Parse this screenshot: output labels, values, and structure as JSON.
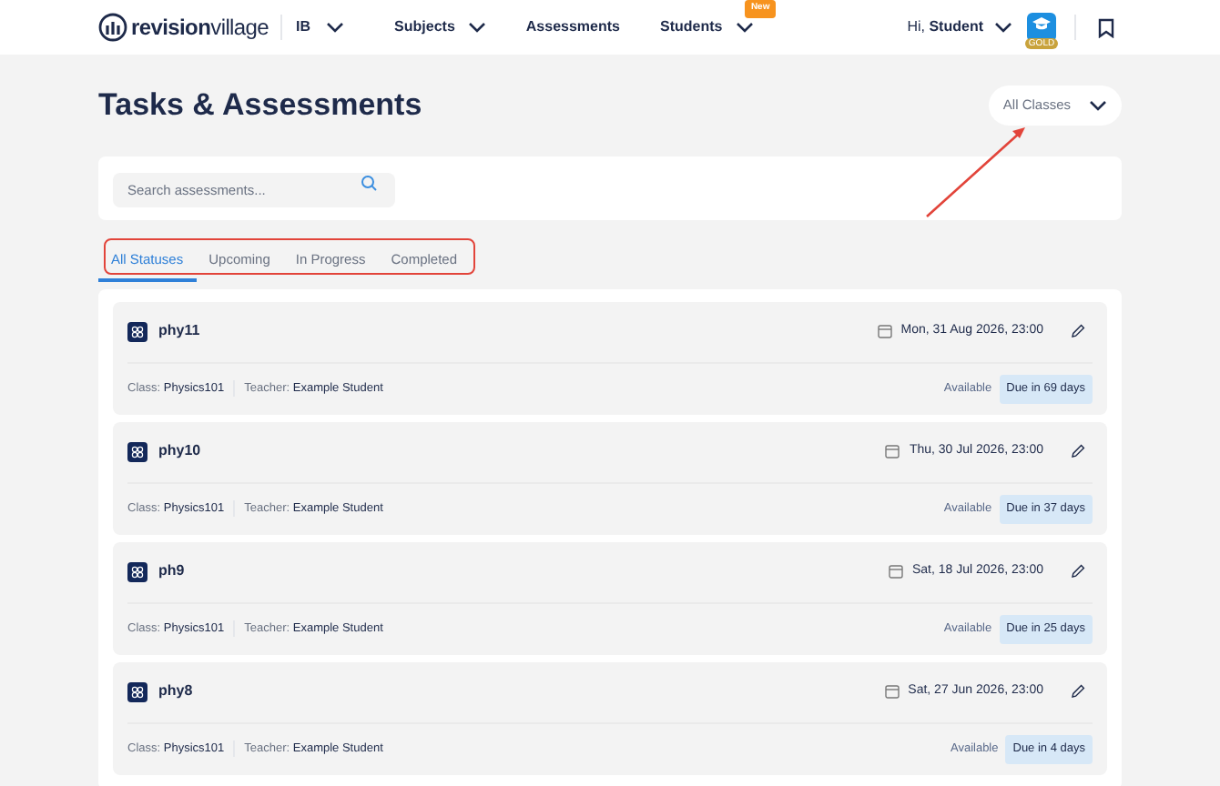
{
  "header": {
    "logo": {
      "bold": "revision",
      "light": "village"
    },
    "curriculum": "IB",
    "nav": [
      {
        "label": "Subjects",
        "dropdown": true
      },
      {
        "label": "Assessments",
        "dropdown": false
      },
      {
        "label": "Students",
        "dropdown": true,
        "badge": "New"
      }
    ],
    "greeting": "Hi,",
    "user": "Student",
    "membership": "GOLD"
  },
  "page": {
    "title": "Tasks & Assessments",
    "class_filter": "All Classes"
  },
  "search": {
    "placeholder": "Search assessments..."
  },
  "tabs": [
    {
      "label": "All Statuses",
      "selected": true
    },
    {
      "label": "Upcoming",
      "selected": false
    },
    {
      "label": "In Progress",
      "selected": false
    },
    {
      "label": "Completed",
      "selected": false
    }
  ],
  "assessments": [
    {
      "name": "phy11",
      "date": "Mon, 31 Aug 2026, 23:00",
      "class_label": "Class:",
      "class": "Physics101",
      "teacher_label": "Teacher:",
      "teacher": "Example Student",
      "status": "Available",
      "due": "Due in 69 days"
    },
    {
      "name": "phy10",
      "date": "Thu, 30 Jul 2026, 23:00",
      "class_label": "Class:",
      "class": "Physics101",
      "teacher_label": "Teacher:",
      "teacher": "Example Student",
      "status": "Available",
      "due": "Due in 37 days"
    },
    {
      "name": "ph9",
      "date": "Sat, 18 Jul 2026, 23:00",
      "class_label": "Class:",
      "class": "Physics101",
      "teacher_label": "Teacher:",
      "teacher": "Example Student",
      "status": "Available",
      "due": "Due in 25 days"
    },
    {
      "name": "phy8",
      "date": "Sat, 27 Jun 2026, 23:00",
      "class_label": "Class:",
      "class": "Physics101",
      "teacher_label": "Teacher:",
      "teacher": "Example Student",
      "status": "Available",
      "due": "Due in 4 days"
    }
  ]
}
